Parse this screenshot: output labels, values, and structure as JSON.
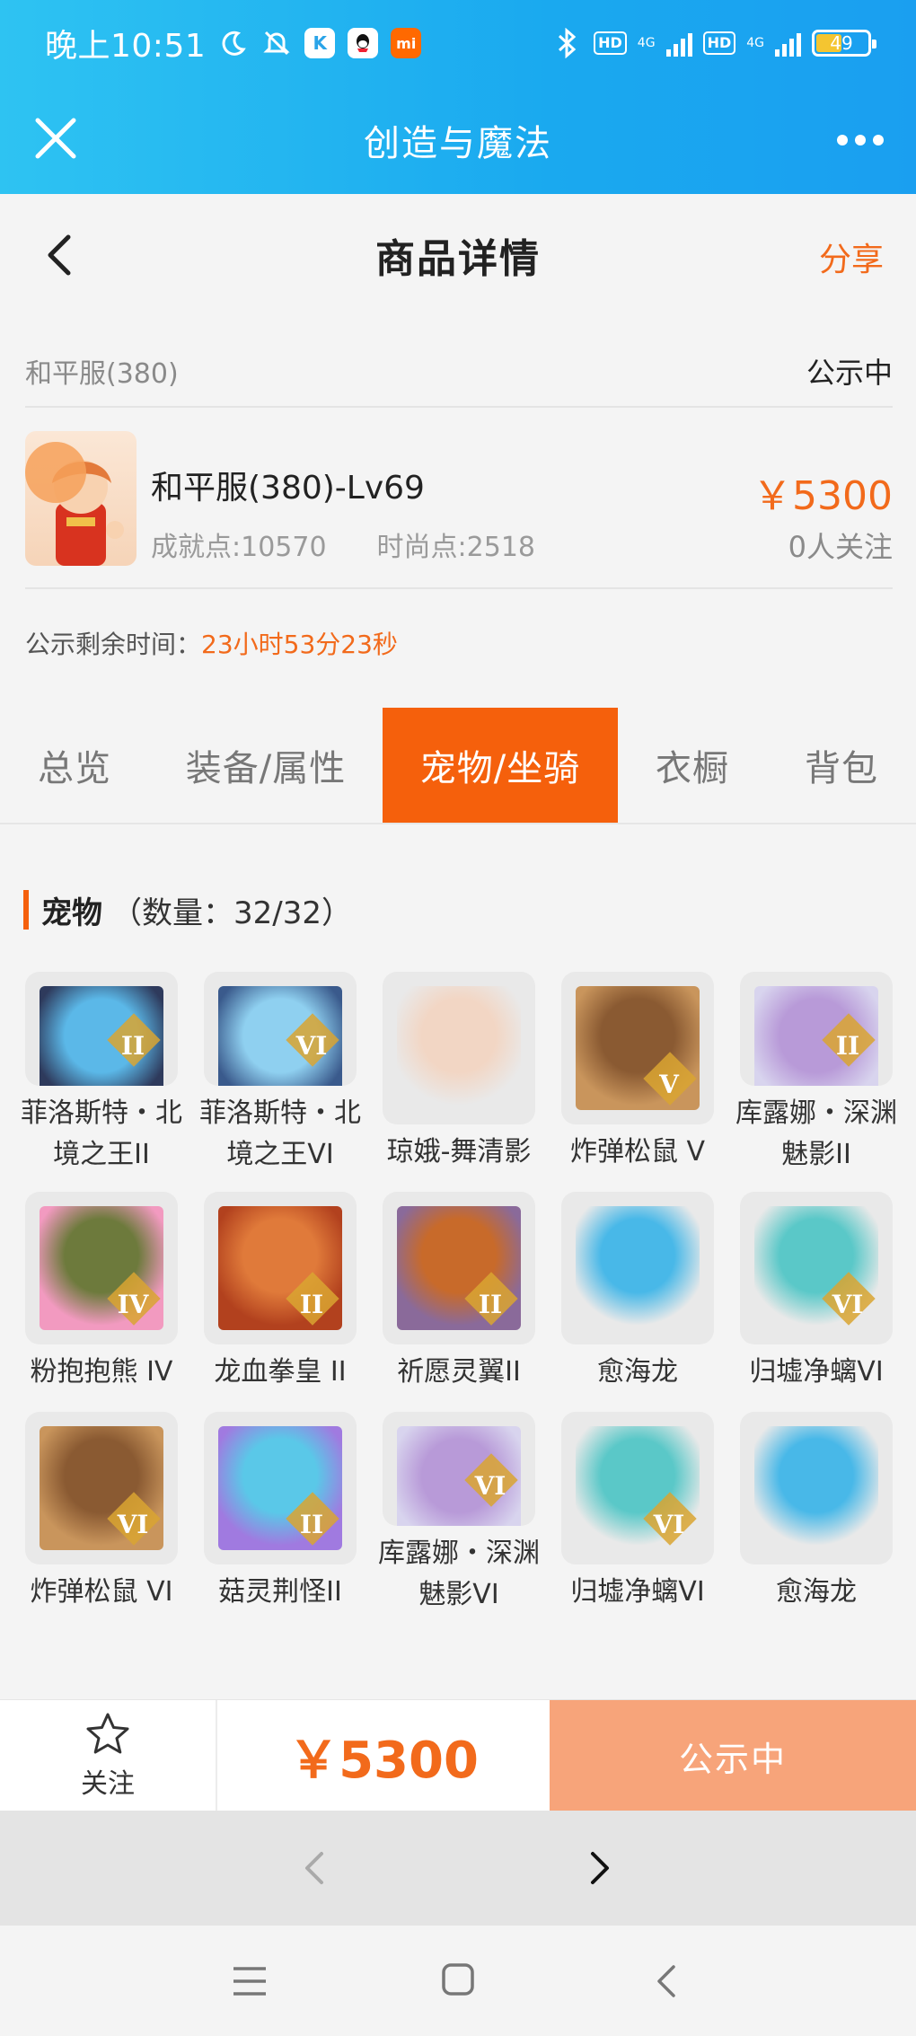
{
  "status_bar": {
    "time": "晚上10:51",
    "badges": [
      "moon-icon",
      "bell-off-icon",
      "k-app-icon",
      "qq-icon",
      "mi-icon"
    ],
    "k_label": "K",
    "mi_label": "mi",
    "hd1": "HD",
    "net1": "4G",
    "hd2": "HD",
    "net2": "4G",
    "battery": "49"
  },
  "app_bar": {
    "title": "创造与魔法"
  },
  "header": {
    "title": "商品详情",
    "share_label": "分享"
  },
  "listing": {
    "server": "和平服(380)",
    "status": "公示中",
    "name": "和平服(380)-Lv69",
    "achievement": "成就点:10570",
    "fashion": "时尚点:2518",
    "price": "￥5300",
    "follows": "0人关注",
    "countdown_label": "公示剩余时间：",
    "countdown_value": "23小时53分23秒"
  },
  "tabs": [
    {
      "label": "总览",
      "active": false
    },
    {
      "label": "装备/属性",
      "active": false
    },
    {
      "label": "宠物/坐骑",
      "active": true
    },
    {
      "label": "衣橱",
      "active": false
    },
    {
      "label": "背包",
      "active": false
    }
  ],
  "pets_section": {
    "title": "宠物",
    "count": "（数量：32/32）"
  },
  "pets": [
    {
      "name": "菲洛斯特・北境之王II",
      "rank": "II",
      "colors": [
        "#2e3a5c",
        "#5bb8e8"
      ]
    },
    {
      "name": "菲洛斯特・北境之王VI",
      "rank": "VI",
      "colors": [
        "#3a5a8c",
        "#8fd0f0"
      ]
    },
    {
      "name": "琼娥-舞清影",
      "rank": "",
      "colors": [
        "#e9e9e9",
        "#f2d6c4"
      ]
    },
    {
      "name": "炸弹松鼠 V",
      "rank": "V",
      "colors": [
        "#c9955c",
        "#8a5a32"
      ]
    },
    {
      "name": "库露娜・深渊魅影II",
      "rank": "II",
      "colors": [
        "#d8d4ee",
        "#b89ad8"
      ]
    },
    {
      "name": "粉抱抱熊 IV",
      "rank": "IV",
      "colors": [
        "#f29ac0",
        "#6d7a3c"
      ]
    },
    {
      "name": "龙血拳皇 II",
      "rank": "II",
      "colors": [
        "#b2411e",
        "#e07a3a"
      ]
    },
    {
      "name": "祈愿灵翼II",
      "rank": "II",
      "colors": [
        "#8a6a9a",
        "#c86a2a"
      ]
    },
    {
      "name": "愈海龙",
      "rank": "",
      "colors": [
        "#e9e9e9",
        "#48b8e8"
      ]
    },
    {
      "name": "归墟净螭VI",
      "rank": "VI",
      "colors": [
        "#e9e9e9",
        "#5ac8c8"
      ]
    },
    {
      "name": "炸弹松鼠 VI",
      "rank": "VI",
      "colors": [
        "#c9955c",
        "#8a5a32"
      ]
    },
    {
      "name": "菇灵荆怪II",
      "rank": "II",
      "colors": [
        "#a07ae0",
        "#5ac8e8"
      ]
    },
    {
      "name": "库露娜・深渊魅影VI",
      "rank": "VI",
      "colors": [
        "#d8d4ee",
        "#b89ad8"
      ]
    },
    {
      "name": "归墟净螭VI",
      "rank": "VI",
      "colors": [
        "#e9e9e9",
        "#5ac8c8"
      ]
    },
    {
      "name": "愈海龙",
      "rank": "",
      "colors": [
        "#e9e9e9",
        "#48b8e8"
      ]
    }
  ],
  "action_bar": {
    "follow_label": "关注",
    "price": "￥5300",
    "button_label": "公示中"
  },
  "colors": {
    "accent": "#f26a1b",
    "tab_active": "#f5600c",
    "button_disabled": "#f7a47a",
    "app_bar": "#1aa9ef"
  }
}
